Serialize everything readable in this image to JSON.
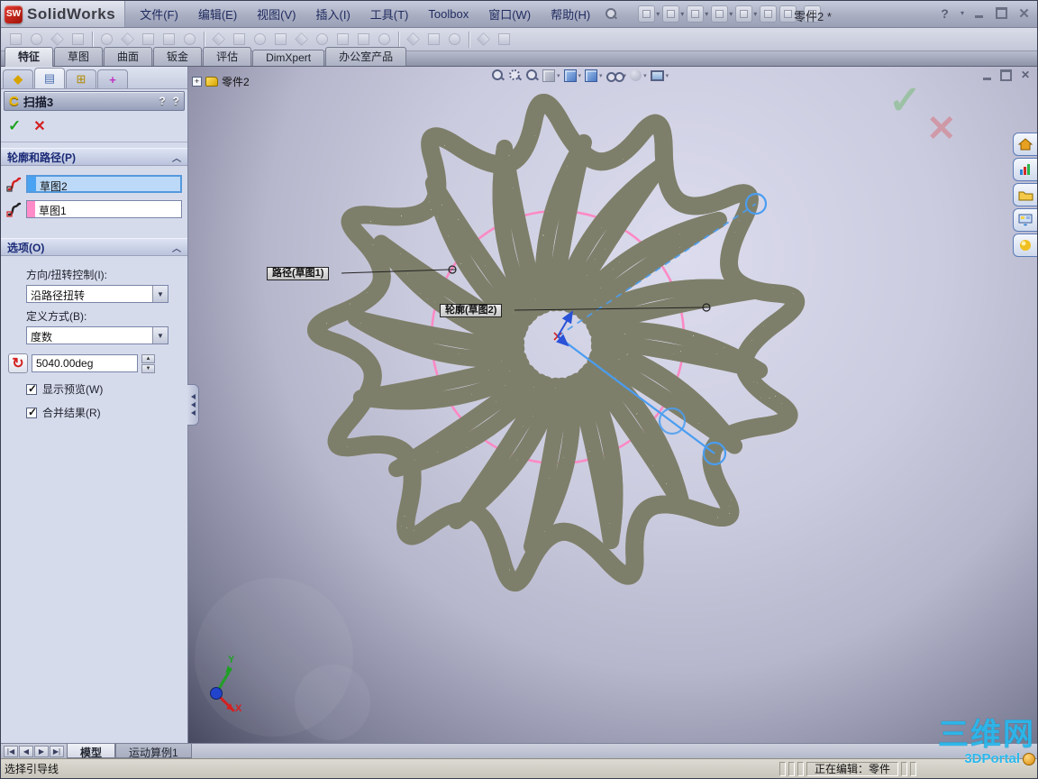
{
  "titlebar": {
    "logo_sw": "SW",
    "logo_text": "SolidWorks",
    "document_title": "零件2 *",
    "help_glyph": "?"
  },
  "menubar": {
    "items": [
      "文件(F)",
      "编辑(E)",
      "视图(V)",
      "插入(I)",
      "工具(T)",
      "Toolbox",
      "窗口(W)",
      "帮助(H)"
    ]
  },
  "ribbon_tabs": {
    "items": [
      "特征",
      "草图",
      "曲面",
      "钣金",
      "评估",
      "DimXpert",
      "办公室产品"
    ],
    "active": "特征"
  },
  "feature_tree": {
    "expand_glyph": "+",
    "root_label": "零件2"
  },
  "property_manager": {
    "title": "扫描3",
    "help_flyout": "?",
    "help": "?",
    "icons": {
      "accept": "✓",
      "cancel": "✕",
      "rotate": "↻",
      "chevron_up": "︿",
      "dropdown": "▼",
      "spin_up": "▲",
      "spin_down": "▼"
    },
    "profile_path": {
      "header": "轮廓和路径(P)",
      "profile_value": "草图2",
      "path_value": "草图1",
      "profile_swatch_color": "#4aa2f2",
      "path_swatch_color": "#ff8cc8"
    },
    "options": {
      "header": "选项(O)",
      "orientation_label": "方向/扭转控制(I):",
      "orientation_value": "沿路径扭转",
      "define_by_label": "定义方式(B):",
      "define_by_value": "度数",
      "angle_value": "5040.00deg",
      "show_preview_label": "显示预览(W)",
      "merge_result_label": "合并结果(R)"
    }
  },
  "viewport": {
    "callouts": {
      "path": "路径(草图1)",
      "profile": "轮廓(草图2)"
    },
    "triad": {
      "x_label": "X",
      "y_label": "Y"
    },
    "watermark_top": "三维网",
    "watermark_bottom": "3DPortal"
  },
  "bottom_tabs": {
    "items": [
      "模型",
      "运动算例1"
    ],
    "active": "模型"
  },
  "statusbar": {
    "left": "选择引导线",
    "editing": "正在编辑：零件"
  },
  "colors": {
    "selection_blue": "#bcd9f8",
    "path_pink": "#ff85c2",
    "preview_blue": "#4a9df0",
    "tube_fill": "#eeebd8",
    "tube_edge": "#90917f",
    "tube_speckle": "#7e7f6a",
    "watermark_cyan": "#2ab7ec"
  }
}
